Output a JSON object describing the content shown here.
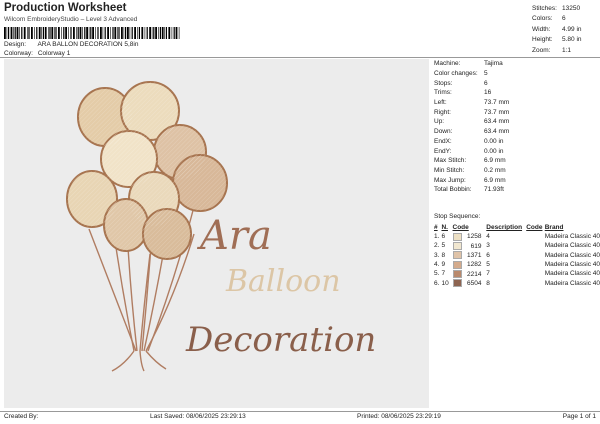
{
  "header": {
    "title": "Production Worksheet",
    "subtitle": "Wilcom EmbroideryStudio – Level 3 Advanced",
    "design_label": "Design:",
    "design_value": "ARA BALLON DECORATION 5,8in",
    "colorway_label": "Colorway:",
    "colorway_value": "Colorway 1"
  },
  "stats": [
    {
      "label": "Stitches:",
      "value": "13250"
    },
    {
      "label": "Colors:",
      "value": "6"
    },
    {
      "label": "Width:",
      "value": "4.99 in"
    },
    {
      "label": "Height:",
      "value": "5.80 in"
    },
    {
      "label": "Zoom:",
      "value": "1:1"
    }
  ],
  "properties": [
    {
      "label": "Machine:",
      "value": "Tajima"
    },
    {
      "label": "Color changes:",
      "value": "5"
    },
    {
      "label": "Stops:",
      "value": "6"
    },
    {
      "label": "Trims:",
      "value": "16"
    },
    {
      "label": "Left:",
      "value": "73.7 mm"
    },
    {
      "label": "Right:",
      "value": "73.7 mm"
    },
    {
      "label": "Up:",
      "value": "63.4 mm"
    },
    {
      "label": "Down:",
      "value": "63.4 mm"
    },
    {
      "label": "EndX:",
      "value": "0.00 in"
    },
    {
      "label": "EndY:",
      "value": "0.00 in"
    },
    {
      "label": "Max Stitch:",
      "value": "6.9 mm"
    },
    {
      "label": "Min Stitch:",
      "value": "0.2 mm"
    },
    {
      "label": "Max Jump:",
      "value": "6.9 mm"
    },
    {
      "label": "Total Bobbin:",
      "value": "71.93ft"
    }
  ],
  "sequence": {
    "heading": "Stop Sequence:",
    "columns": [
      "#",
      "N.",
      "Code",
      "Description",
      "Code",
      "Brand"
    ],
    "rows": [
      {
        "idx": "1.",
        "n": "6",
        "color": "#ede0c4",
        "stitches": "1258",
        "desc": "4",
        "code": "",
        "brand": "Madeira Classic 40"
      },
      {
        "idx": "2.",
        "n": "5",
        "color": "#f1e7d0",
        "stitches": "619",
        "desc": "3",
        "code": "",
        "brand": "Madeira Classic 40"
      },
      {
        "idx": "3.",
        "n": "8",
        "color": "#dfc3a8",
        "stitches": "1371",
        "desc": "6",
        "code": "",
        "brand": "Madeira Classic 40"
      },
      {
        "idx": "4.",
        "n": "9",
        "color": "#d4ab8c",
        "stitches": "1282",
        "desc": "5",
        "code": "",
        "brand": "Madeira Classic 40"
      },
      {
        "idx": "5.",
        "n": "7",
        "color": "#b9896c",
        "stitches": "2214",
        "desc": "7",
        "code": "",
        "brand": "Madeira Classic 40"
      },
      {
        "idx": "6.",
        "n": "10",
        "color": "#8d6451",
        "stitches": "6504",
        "desc": "8",
        "code": "",
        "brand": "Madeira Classic 40"
      }
    ]
  },
  "design": {
    "line1": "Ara",
    "line2": "Balloon",
    "line3": "Decoration",
    "colors": {
      "string": "#b07d62",
      "dark": "#8a5f4b",
      "light": "#d8c2a4"
    }
  },
  "footer": {
    "created_by": "Created By:",
    "last_saved": "Last Saved: 08/06/2025 23:29:13",
    "printed": "Printed: 08/06/2025 23:29:19",
    "page": "Page 1 of 1"
  }
}
